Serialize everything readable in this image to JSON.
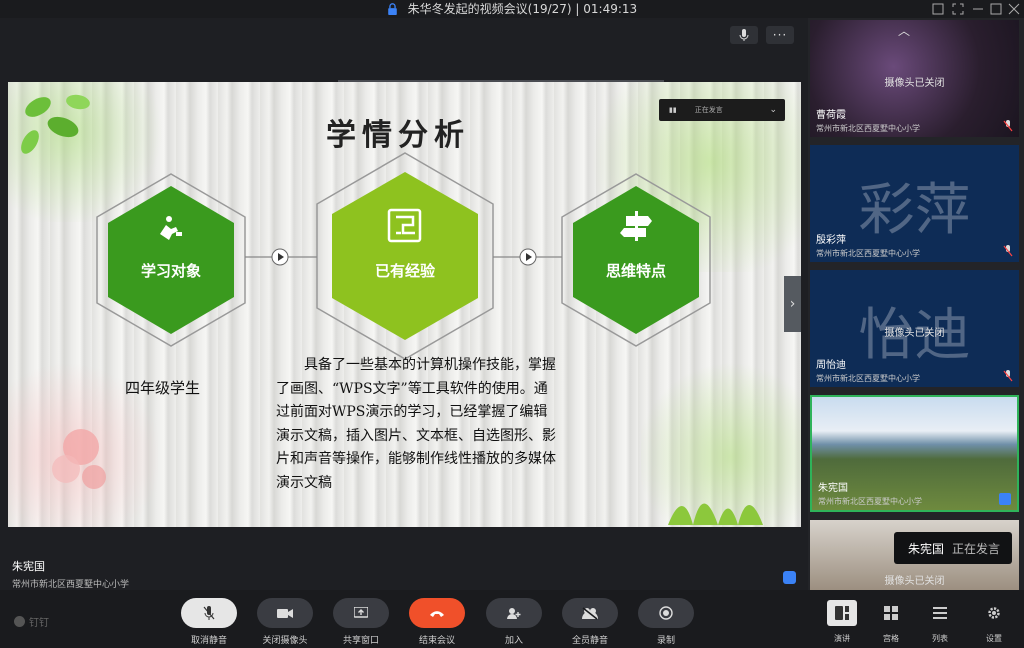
{
  "window": {
    "title": "朱华冬发起的视频会议(19/27) | 01:49:13"
  },
  "slide": {
    "title": "学情分析",
    "hexagons": [
      {
        "label": "学习对象",
        "icon": "person-stairs-icon",
        "color": "#3a9a1e"
      },
      {
        "label": "已有经验",
        "icon": "maze-icon",
        "color": "#8ec21f"
      },
      {
        "label": "思维特点",
        "icon": "signpost-icon",
        "color": "#3a9a1e"
      }
    ],
    "grade_text": "四年级学生",
    "paragraph": "具备了一些基本的计算机操作技能，掌握了画图、“WPS文字”等工具软件的使用。通过前面对WPS演示的学习，已经掌握了编辑演示文稿，插入图片、文本框、自选图形、影片和声音等操作，能够制作线性播放的多媒体演示文稿",
    "overlay_status": "正在发言"
  },
  "presenter": {
    "name": "朱宪国",
    "org": "常州市新北区西夏墅中心小学"
  },
  "participants": [
    {
      "name": "曹荷霞",
      "org": "常州市新北区西夏墅中心小学",
      "camera_status": "摄像头已关闭",
      "big_name": "",
      "bg": "flowers"
    },
    {
      "name": "殷彩萍",
      "org": "常州市新北区西夏墅中心小学",
      "camera_status": "摄像头已关闭",
      "big_name": "彩萍",
      "bg": "blue"
    },
    {
      "name": "周怡迪",
      "org": "常州市新北区西夏墅中心小学",
      "camera_status": "摄像头已关闭",
      "big_name": "怡迪",
      "bg": "blue"
    },
    {
      "name": "朱宪国",
      "org": "常州市新北区西夏墅中心小学",
      "camera_status": "",
      "big_name": "",
      "bg": "landscape"
    },
    {
      "name": "",
      "org": "",
      "camera_status": "摄像头已关闭",
      "big_name": "",
      "bg": "room"
    }
  ],
  "speaking_toast": {
    "name": "朱宪国",
    "status": "正在发言"
  },
  "toolbar": {
    "pin_label": "钉钉",
    "buttons": [
      {
        "label": "取消静音",
        "icon": "mic-muted-icon"
      },
      {
        "label": "关闭摄像头",
        "icon": "camera-icon"
      },
      {
        "label": "共享窗口",
        "icon": "share-screen-icon"
      },
      {
        "label": "结束会议",
        "icon": "hangup-icon"
      },
      {
        "label": "加入",
        "icon": "add-person-icon"
      },
      {
        "label": "全员静音",
        "icon": "mute-all-icon"
      },
      {
        "label": "录制",
        "icon": "record-icon"
      }
    ],
    "right_buttons": [
      {
        "label": "演讲",
        "icon": "speaker-layout-icon"
      },
      {
        "label": "宫格",
        "icon": "grid-layout-icon"
      },
      {
        "label": "列表",
        "icon": "list-layout-icon"
      },
      {
        "label": "设置",
        "icon": "gear-icon"
      }
    ]
  },
  "colors": {
    "accent_red": "#f0502a",
    "tile_blue": "#0e2c56",
    "active_border": "#2fb35a"
  }
}
